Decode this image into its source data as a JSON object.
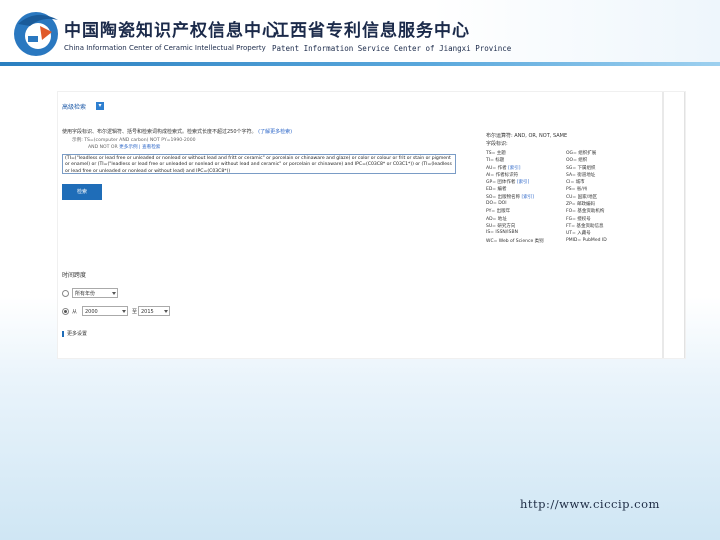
{
  "header": {
    "org1_cn": "中国陶瓷知识产权信息中心",
    "org1_en": "China Information Center of Ceramic Intellectual Property",
    "org2_cn": "江西省专利信息服务中心",
    "org2_en": "Patent Information Service Center of Jiangxi Province"
  },
  "search": {
    "mode_label": "高级检索",
    "mode_select_symbol": "▾",
    "hint_main": "使用字段标识、布尔逻辑符、括号和检索词构成检索式。检索式长度不超过250个字符。",
    "hint_link": "(了解更多检索)",
    "hint_example": "示例: TS=(computer AND carbon) NOT PY=1990-2000",
    "hint_sub_prefix": "AND NOT OR ",
    "hint_sub_link": "更多示例 | 查看检索",
    "query": "(TI=(\"leadless or lead free or unleaded or nonlead or without lead and fritt or ceramic\" or porcelain or chinaware and glaze) or color or colour or frit or stain or pigment or enamel) or (TI=(\"leadless or lead free or unleaded or nonlead or without lead and ceramic\" or porcelain or chinaware) and IPC=(C03C8* or C03C1*)) or (TI=(leadless or lead free or unleaded or nonlead or without lead) and IPC=(C03C8*))",
    "search_button": "检索",
    "ops_title": "布尔运算符: AND, OR, NOT, SAME",
    "ops_sub": "字段标识:",
    "fields": [
      {
        "left": "TS= 主题",
        "right": "OG= 组织扩展"
      },
      {
        "left": "TI= 标题",
        "right": "OO= 组织",
        "left_link": "",
        "right_link": ""
      },
      {
        "left": "AU= 作者",
        "left_link": "[索引]",
        "right": "SG= 下属组织",
        "right_link": ""
      },
      {
        "left": "AI= 作者标识符",
        "right": "SA= 街道地址"
      },
      {
        "left": "GP= 团体作者",
        "left_link": "[索引]",
        "right": "CI= 城市"
      },
      {
        "left": "ED= 编者",
        "right": "PS= 省/州"
      },
      {
        "left": "SO= 出版物名称",
        "left_link": "[索引]",
        "right": "CU= 国家/地区"
      },
      {
        "left": "DO= DOI",
        "right": "ZP= 邮政编码"
      },
      {
        "left": "PY= 出版年",
        "right": "FO= 基金资助机构"
      },
      {
        "left": "AD= 地址",
        "right": "FG= 授权号"
      },
      {
        "left": "SU= 研究方向",
        "right": "FT= 基金资助信息"
      },
      {
        "left": "IS= ISSN/ISBN",
        "right": "UT= 入藏号"
      },
      {
        "left": "WC= Web of Science 类别",
        "right": "PMID= PubMed ID"
      }
    ],
    "time_title": "时间跨度",
    "time_all_option": "所有年份",
    "time_from_label": "从",
    "time_from": "2000",
    "time_to_label": "至",
    "time_to": "2015",
    "more_settings": "更多设置"
  },
  "footer": {
    "url": "http://www.ciccip.com"
  }
}
